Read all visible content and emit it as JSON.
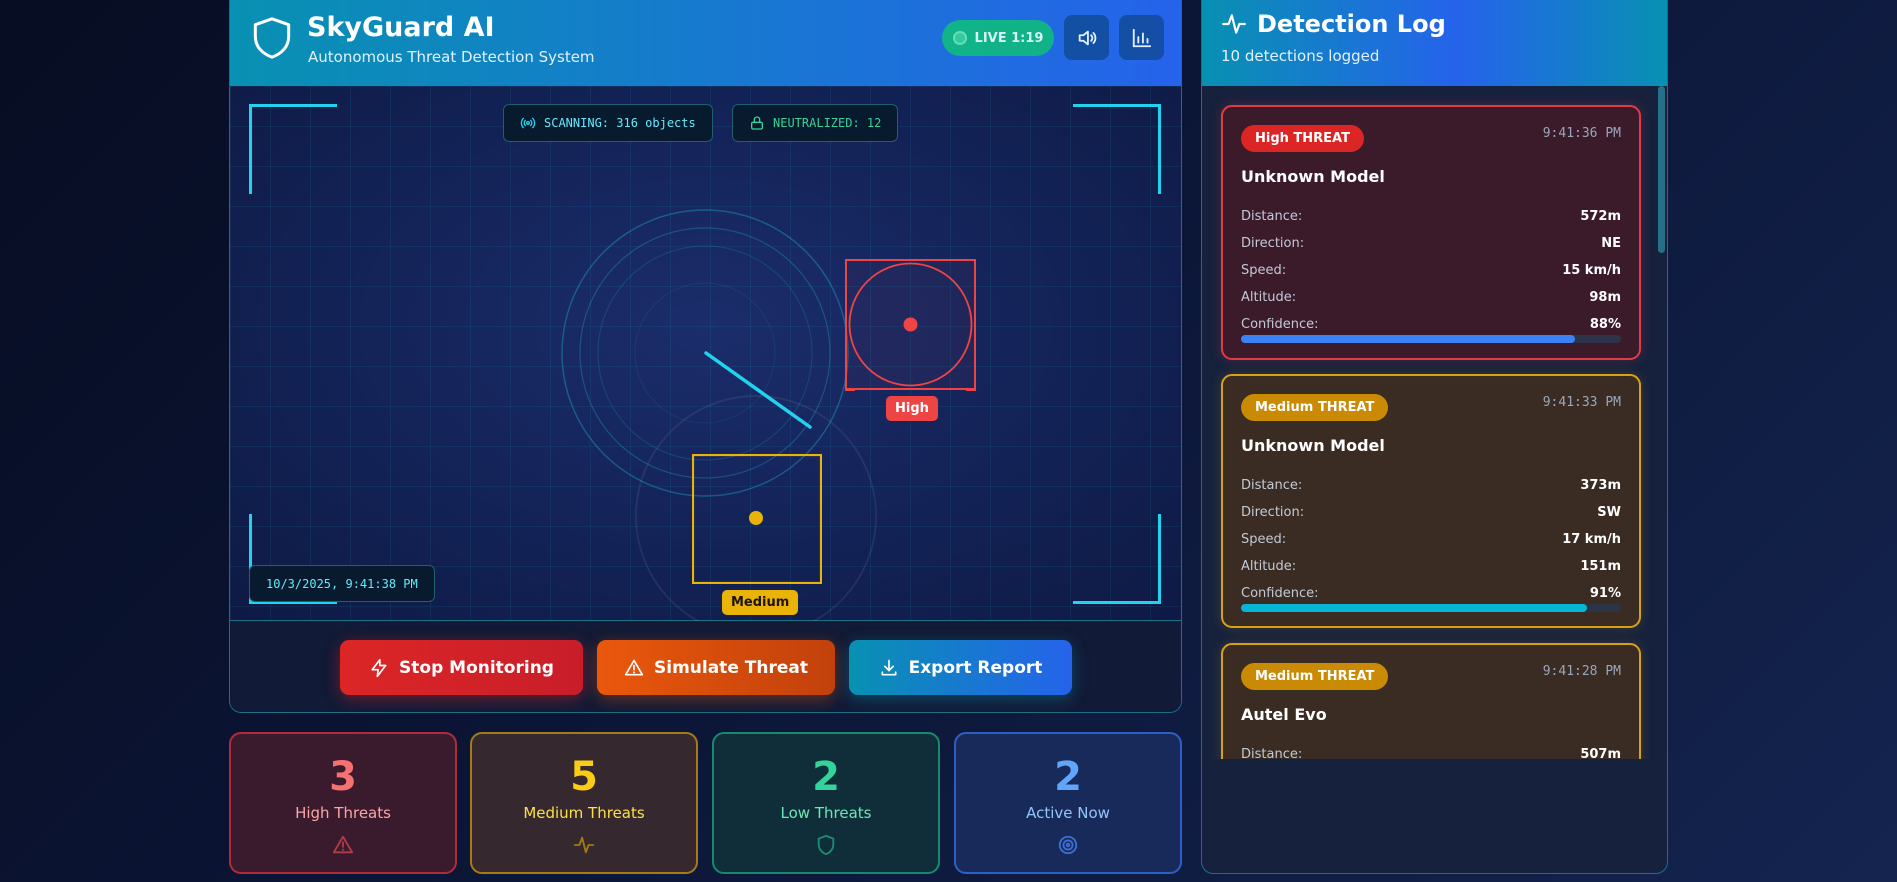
{
  "header": {
    "title": "SkyGuard AI",
    "subtitle": "Autonomous Threat Detection System",
    "live_label": "LIVE 1:19",
    "sound_icon": "speaker-icon",
    "stats_icon": "bar-chart-icon"
  },
  "scanner": {
    "scanning_text": "SCANNING: 316 objects",
    "neutralized_text": "NEUTRALIZED: 12",
    "timestamp": "10/3/2025, 9:41:38 PM",
    "targets": [
      {
        "label": "High",
        "color": "#ef4444"
      },
      {
        "label": "Medium",
        "color": "#eab308"
      }
    ]
  },
  "controls": {
    "stop": "Stop Monitoring",
    "simulate": "Simulate Threat",
    "export": "Export Report"
  },
  "stats": [
    {
      "value": "3",
      "label": "High Threats",
      "icon": "warning-icon",
      "color": "#f87171"
    },
    {
      "value": "5",
      "label": "Medium Threats",
      "icon": "pulse-icon",
      "color": "#facc15"
    },
    {
      "value": "2",
      "label": "Low Threats",
      "icon": "shield-icon",
      "color": "#34d399"
    },
    {
      "value": "2",
      "label": "Active Now",
      "icon": "target-icon",
      "color": "#60a5fa"
    }
  ],
  "log": {
    "title": "Detection Log",
    "subtitle": "10 detections logged",
    "field_labels": {
      "distance": "Distance:",
      "direction": "Direction:",
      "speed": "Speed:",
      "altitude": "Altitude:",
      "confidence": "Confidence:"
    },
    "entries": [
      {
        "threat": "High THREAT",
        "time": "9:41:36 PM",
        "model": "Unknown Model",
        "distance": "572m",
        "direction": "NE",
        "speed": "15 km/h",
        "altitude": "98m",
        "confidence": "88%",
        "confidence_value": 0.88,
        "bar_color": "#3b82f6"
      },
      {
        "threat": "Medium THREAT",
        "time": "9:41:33 PM",
        "model": "Unknown Model",
        "distance": "373m",
        "direction": "SW",
        "speed": "17 km/h",
        "altitude": "151m",
        "confidence": "91%",
        "confidence_value": 0.91,
        "bar_color": "#06b6d4"
      },
      {
        "threat": "Medium THREAT",
        "time": "9:41:28 PM",
        "model": "Autel Evo",
        "distance": "507m"
      }
    ]
  },
  "colors": {
    "accent": "#22d3ee",
    "high": "#dc2626",
    "medium": "#ca8a04",
    "stop_btn": "#dc2626",
    "simulate_btn": "#ea580c",
    "export_btn": "#0891b2"
  }
}
